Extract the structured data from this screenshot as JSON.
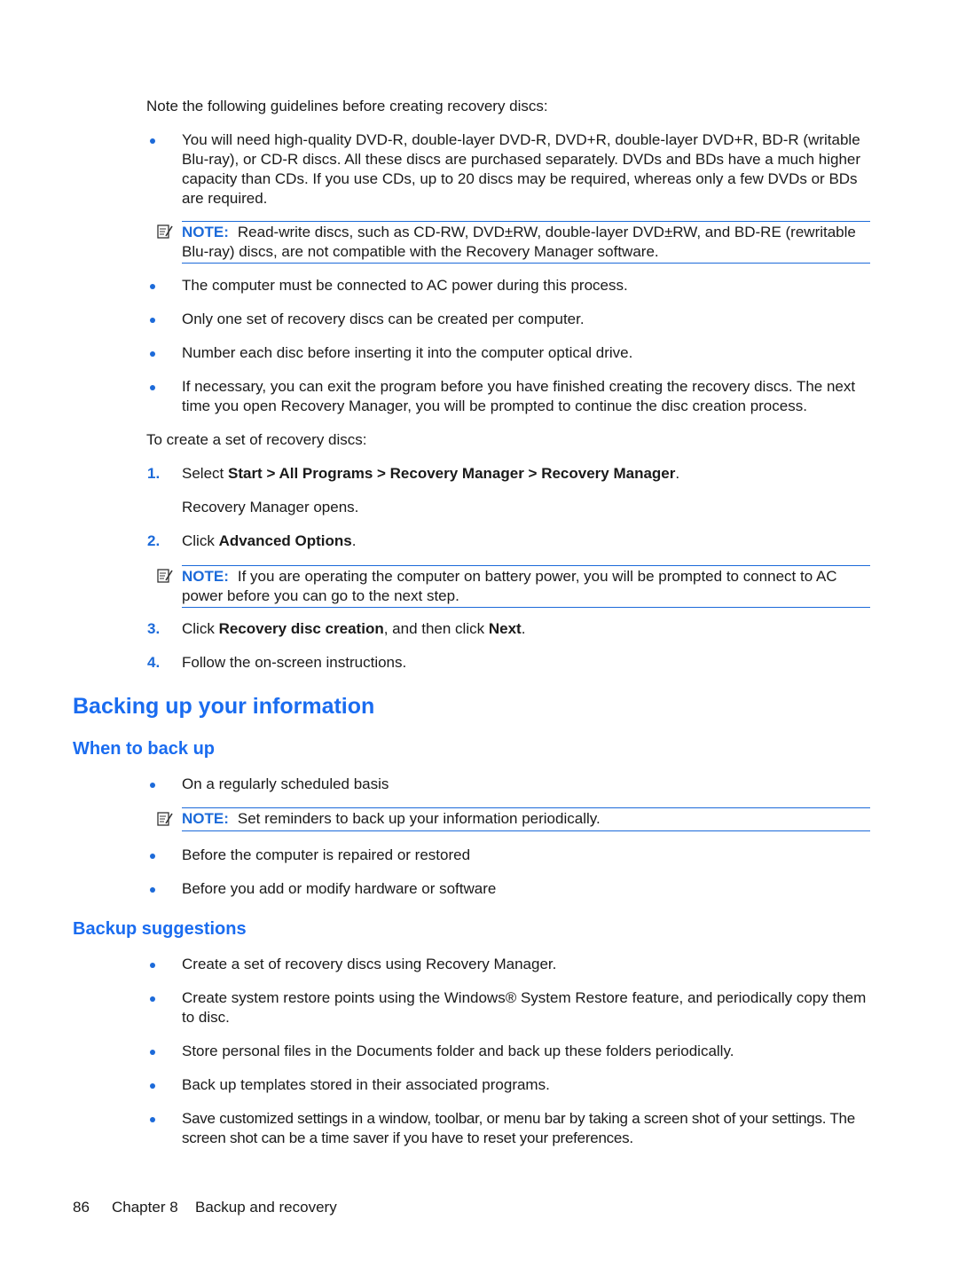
{
  "intro": "Note the following guidelines before creating recovery discs:",
  "guidelines": [
    "You will need high-quality DVD-R, double-layer DVD-R, DVD+R, double-layer DVD+R, BD-R (writable Blu-ray), or CD-R discs. All these discs are purchased separately. DVDs and BDs have a much higher capacity than CDs. If you use CDs, up to 20 discs may be required, whereas only a few DVDs or BDs are required.",
    "The computer must be connected to AC power during this process.",
    "Only one set of recovery discs can be created per computer.",
    "Number each disc before inserting it into the computer optical drive.",
    "If necessary, you can exit the program before you have finished creating the recovery discs. The next time you open Recovery Manager, you will be prompted to continue the disc creation process."
  ],
  "note_label": "NOTE:",
  "notes": {
    "discs": "Read-write discs, such as CD-RW, DVD±RW, double-layer DVD±RW, and BD-RE (rewritable Blu-ray) discs, are not compatible with the Recovery Manager software.",
    "battery": "If you are operating the computer on battery power, you will be prompted to connect to AC power before you can go to the next step.",
    "reminders": "Set reminders to back up your information periodically."
  },
  "create_intro": "To create a set of recovery discs:",
  "steps": [
    {
      "num": "1.",
      "pre": "Select ",
      "bold": "Start > All Programs > Recovery Manager > Recovery Manager",
      "post": ".",
      "sub": "Recovery Manager opens."
    },
    {
      "num": "2.",
      "pre": "Click ",
      "bold": "Advanced Options",
      "post": "."
    },
    {
      "num": "3.",
      "pre": "Click ",
      "bold": "Recovery disc creation",
      "mid": ", and then click ",
      "bold2": "Next",
      "post": "."
    },
    {
      "num": "4.",
      "pre": "Follow the on-screen instructions."
    }
  ],
  "section_title": "Backing up your information",
  "when": {
    "title": "When to back up",
    "items": [
      "On a regularly scheduled basis",
      "Before the computer is repaired or restored",
      "Before you add or modify hardware or software"
    ]
  },
  "suggestions": {
    "title": "Backup suggestions",
    "items": [
      "Create a set of recovery discs using Recovery Manager.",
      "Create system restore points using the Windows® System Restore feature, and periodically copy them to disc.",
      "Store personal files in the Documents folder and back up these folders periodically.",
      "Back up templates stored in their associated programs.",
      "Save customized settings in a window, toolbar, or menu bar by taking a screen shot of your settings. The screen shot can be a time saver if you have to reset your preferences."
    ]
  },
  "footer": {
    "page_number": "86",
    "chapter": "Chapter 8",
    "chapter_title": "Backup and recovery"
  },
  "colors": {
    "accent": "#1c6ad9",
    "heading": "#1a6cf0"
  }
}
